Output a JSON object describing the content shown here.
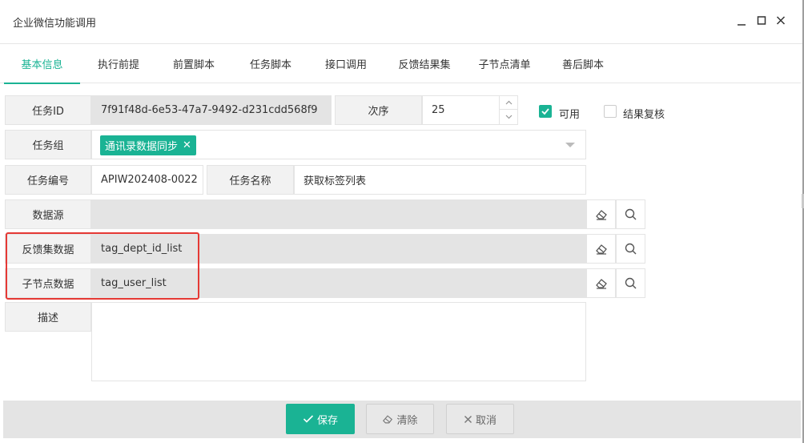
{
  "window": {
    "title": "企业微信功能调用"
  },
  "tabs": [
    {
      "label": "基本信息",
      "active": true
    },
    {
      "label": "执行前提"
    },
    {
      "label": "前置脚本"
    },
    {
      "label": "任务脚本"
    },
    {
      "label": "接口调用"
    },
    {
      "label": "反馈结果集"
    },
    {
      "label": "子节点清单"
    },
    {
      "label": "善后脚本"
    }
  ],
  "form": {
    "task_id_label": "任务ID",
    "task_id_value": "7f91f48d-6e53-47a7-9492-d231cdd568f9",
    "order_label": "次序",
    "order_value": "25",
    "enabled_label": "可用",
    "enabled_checked": true,
    "review_label": "结果复核",
    "review_checked": false,
    "group_label": "任务组",
    "group_tag": "通讯录数据同步",
    "task_code_label": "任务编号",
    "task_code_value": "APIW202408-0022",
    "task_name_label": "任务名称",
    "task_name_value": "获取标签列表",
    "datasource_label": "数据源",
    "datasource_value": "",
    "feedback_label": "反馈集数据",
    "feedback_value": "tag_dept_id_list",
    "child_label": "子节点数据",
    "child_value": "tag_user_list",
    "desc_label": "描述",
    "desc_value": ""
  },
  "footer": {
    "save_label": "保存",
    "clear_label": "清除",
    "cancel_label": "取消"
  },
  "colors": {
    "accent": "#1ab394",
    "highlight": "#e53935",
    "field_gray": "#e4e4e4"
  },
  "icons": [
    "minimize-icon",
    "maximize-icon",
    "close-icon",
    "eraser-icon",
    "search-icon",
    "check-icon"
  ]
}
